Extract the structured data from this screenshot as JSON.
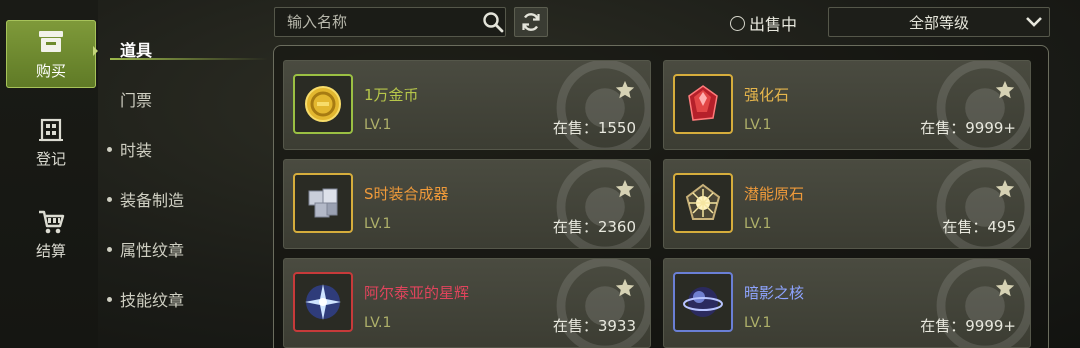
{
  "nav": {
    "rail": [
      {
        "label": "购买",
        "icon": "shop-icon",
        "active": true
      },
      {
        "label": "登记",
        "icon": "register-building-icon",
        "active": false
      },
      {
        "label": "结算",
        "icon": "cart-icon",
        "active": false
      }
    ],
    "submenu": [
      {
        "label": "道具",
        "active": true
      },
      {
        "label": "门票",
        "active": false
      },
      {
        "label": "时装",
        "active": false
      },
      {
        "label": "装备制造",
        "active": false
      },
      {
        "label": "属性纹章",
        "active": false
      },
      {
        "label": "技能纹章",
        "active": false
      }
    ]
  },
  "toolbar": {
    "search_placeholder": "输入名称",
    "on_sale_label": "出售中",
    "level_filter": "全部等级"
  },
  "items": [
    {
      "name": "1万金币",
      "level": "LV.1",
      "stock": "在售：1550",
      "rarity_color": "#b6c64a",
      "frame": "gold",
      "icon": "gold-coin-icon"
    },
    {
      "name": "强化石",
      "level": "LV.1",
      "stock": "在售：9999+",
      "rarity_color": "#e6b64c",
      "frame": "gold",
      "icon": "red-crystal-icon"
    },
    {
      "name": "S时装合成器",
      "level": "LV.1",
      "stock": "在售：2360",
      "rarity_color": "#ef9a3a",
      "frame": "gold",
      "icon": "synthesizer-cubes-icon"
    },
    {
      "name": "潜能原石",
      "level": "LV.1",
      "stock": "在售：495",
      "rarity_color": "#ef9a3a",
      "frame": "gold",
      "icon": "potential-stone-icon"
    },
    {
      "name": "阿尔泰亚的星辉",
      "level": "LV.1",
      "stock": "在售：3933",
      "rarity_color": "#e0445c",
      "frame": "red",
      "icon": "star-shard-icon"
    },
    {
      "name": "暗影之核",
      "level": "LV.1",
      "stock": "在售：9999+",
      "rarity_color": "#8ea4ff",
      "frame": "blue",
      "icon": "shadow-core-icon"
    }
  ]
}
